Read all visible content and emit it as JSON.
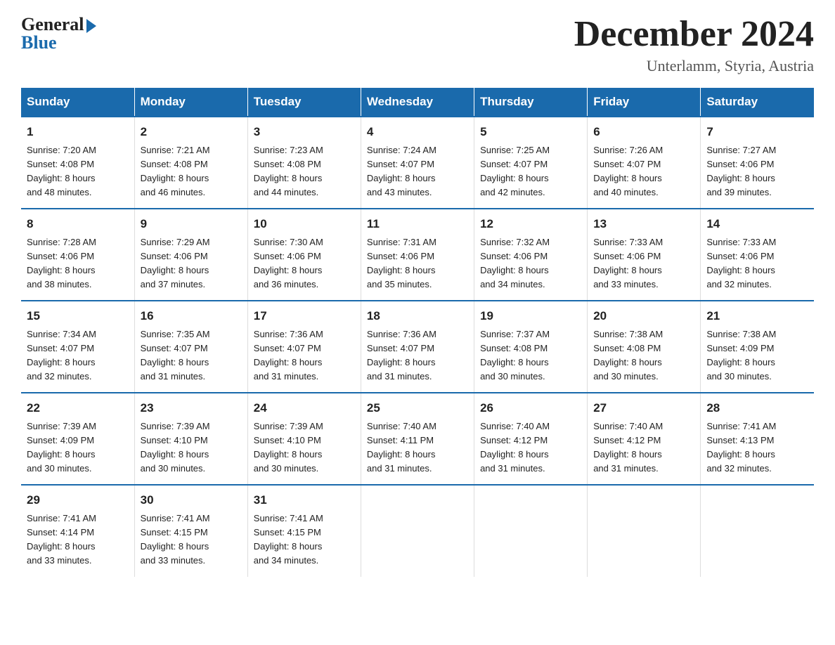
{
  "header": {
    "logo_general": "General",
    "logo_blue": "Blue",
    "month_title": "December 2024",
    "location": "Unterlamm, Styria, Austria"
  },
  "days_of_week": [
    "Sunday",
    "Monday",
    "Tuesday",
    "Wednesday",
    "Thursday",
    "Friday",
    "Saturday"
  ],
  "weeks": [
    [
      {
        "day": "1",
        "sunrise": "7:20 AM",
        "sunset": "4:08 PM",
        "daylight": "8 hours and 48 minutes."
      },
      {
        "day": "2",
        "sunrise": "7:21 AM",
        "sunset": "4:08 PM",
        "daylight": "8 hours and 46 minutes."
      },
      {
        "day": "3",
        "sunrise": "7:23 AM",
        "sunset": "4:08 PM",
        "daylight": "8 hours and 44 minutes."
      },
      {
        "day": "4",
        "sunrise": "7:24 AM",
        "sunset": "4:07 PM",
        "daylight": "8 hours and 43 minutes."
      },
      {
        "day": "5",
        "sunrise": "7:25 AM",
        "sunset": "4:07 PM",
        "daylight": "8 hours and 42 minutes."
      },
      {
        "day": "6",
        "sunrise": "7:26 AM",
        "sunset": "4:07 PM",
        "daylight": "8 hours and 40 minutes."
      },
      {
        "day": "7",
        "sunrise": "7:27 AM",
        "sunset": "4:06 PM",
        "daylight": "8 hours and 39 minutes."
      }
    ],
    [
      {
        "day": "8",
        "sunrise": "7:28 AM",
        "sunset": "4:06 PM",
        "daylight": "8 hours and 38 minutes."
      },
      {
        "day": "9",
        "sunrise": "7:29 AM",
        "sunset": "4:06 PM",
        "daylight": "8 hours and 37 minutes."
      },
      {
        "day": "10",
        "sunrise": "7:30 AM",
        "sunset": "4:06 PM",
        "daylight": "8 hours and 36 minutes."
      },
      {
        "day": "11",
        "sunrise": "7:31 AM",
        "sunset": "4:06 PM",
        "daylight": "8 hours and 35 minutes."
      },
      {
        "day": "12",
        "sunrise": "7:32 AM",
        "sunset": "4:06 PM",
        "daylight": "8 hours and 34 minutes."
      },
      {
        "day": "13",
        "sunrise": "7:33 AM",
        "sunset": "4:06 PM",
        "daylight": "8 hours and 33 minutes."
      },
      {
        "day": "14",
        "sunrise": "7:33 AM",
        "sunset": "4:06 PM",
        "daylight": "8 hours and 32 minutes."
      }
    ],
    [
      {
        "day": "15",
        "sunrise": "7:34 AM",
        "sunset": "4:07 PM",
        "daylight": "8 hours and 32 minutes."
      },
      {
        "day": "16",
        "sunrise": "7:35 AM",
        "sunset": "4:07 PM",
        "daylight": "8 hours and 31 minutes."
      },
      {
        "day": "17",
        "sunrise": "7:36 AM",
        "sunset": "4:07 PM",
        "daylight": "8 hours and 31 minutes."
      },
      {
        "day": "18",
        "sunrise": "7:36 AM",
        "sunset": "4:07 PM",
        "daylight": "8 hours and 31 minutes."
      },
      {
        "day": "19",
        "sunrise": "7:37 AM",
        "sunset": "4:08 PM",
        "daylight": "8 hours and 30 minutes."
      },
      {
        "day": "20",
        "sunrise": "7:38 AM",
        "sunset": "4:08 PM",
        "daylight": "8 hours and 30 minutes."
      },
      {
        "day": "21",
        "sunrise": "7:38 AM",
        "sunset": "4:09 PM",
        "daylight": "8 hours and 30 minutes."
      }
    ],
    [
      {
        "day": "22",
        "sunrise": "7:39 AM",
        "sunset": "4:09 PM",
        "daylight": "8 hours and 30 minutes."
      },
      {
        "day": "23",
        "sunrise": "7:39 AM",
        "sunset": "4:10 PM",
        "daylight": "8 hours and 30 minutes."
      },
      {
        "day": "24",
        "sunrise": "7:39 AM",
        "sunset": "4:10 PM",
        "daylight": "8 hours and 30 minutes."
      },
      {
        "day": "25",
        "sunrise": "7:40 AM",
        "sunset": "4:11 PM",
        "daylight": "8 hours and 31 minutes."
      },
      {
        "day": "26",
        "sunrise": "7:40 AM",
        "sunset": "4:12 PM",
        "daylight": "8 hours and 31 minutes."
      },
      {
        "day": "27",
        "sunrise": "7:40 AM",
        "sunset": "4:12 PM",
        "daylight": "8 hours and 31 minutes."
      },
      {
        "day": "28",
        "sunrise": "7:41 AM",
        "sunset": "4:13 PM",
        "daylight": "8 hours and 32 minutes."
      }
    ],
    [
      {
        "day": "29",
        "sunrise": "7:41 AM",
        "sunset": "4:14 PM",
        "daylight": "8 hours and 33 minutes."
      },
      {
        "day": "30",
        "sunrise": "7:41 AM",
        "sunset": "4:15 PM",
        "daylight": "8 hours and 33 minutes."
      },
      {
        "day": "31",
        "sunrise": "7:41 AM",
        "sunset": "4:15 PM",
        "daylight": "8 hours and 34 minutes."
      },
      null,
      null,
      null,
      null
    ]
  ],
  "labels": {
    "sunrise": "Sunrise:",
    "sunset": "Sunset:",
    "daylight": "Daylight:"
  }
}
